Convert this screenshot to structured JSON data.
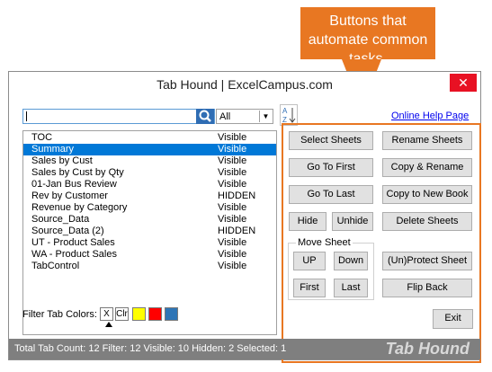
{
  "callout": {
    "text": "Buttons that automate common tasks."
  },
  "window": {
    "title": "Tab Hound | ExcelCampus.com",
    "close_glyph": "✕"
  },
  "toolbar": {
    "search_value": "",
    "filter_value": "All",
    "help_link": "Online Help Page"
  },
  "sheets": [
    {
      "name": "TOC",
      "visibility": "Visible"
    },
    {
      "name": "Summary",
      "visibility": "Visible"
    },
    {
      "name": "Sales by Cust",
      "visibility": "Visible"
    },
    {
      "name": "Sales by Cust by Qty",
      "visibility": "Visible"
    },
    {
      "name": "01-Jan Bus Review",
      "visibility": "Visible"
    },
    {
      "name": "Rev by Customer",
      "visibility": "HIDDEN"
    },
    {
      "name": "Revenue by Category",
      "visibility": "Visible"
    },
    {
      "name": "Source_Data",
      "visibility": "Visible"
    },
    {
      "name": "Source_Data (2)",
      "visibility": "HIDDEN"
    },
    {
      "name": "UT - Product Sales",
      "visibility": "Visible"
    },
    {
      "name": "WA - Product Sales",
      "visibility": "Visible"
    },
    {
      "name": "TabControl",
      "visibility": "Visible"
    }
  ],
  "buttons": {
    "select_sheets": "Select Sheets",
    "rename_sheets": "Rename Sheets",
    "go_to_first": "Go To First",
    "copy_rename": "Copy & Rename",
    "go_to_last": "Go To Last",
    "copy_to_new_book": "Copy to New Book",
    "hide": "Hide",
    "unhide": "Unhide",
    "delete_sheets": "Delete Sheets",
    "move_sheet_group": "Move Sheet",
    "up": "UP",
    "down": "Down",
    "first": "First",
    "last": "Last",
    "unprotect_sheet": "(Un)Protect Sheet",
    "flip_back": "Flip Back",
    "exit": "Exit"
  },
  "filter_colors": {
    "label": "Filter Tab Colors:",
    "clear_x": "X",
    "clear_text": "Clr",
    "swatches": [
      "#ffff00",
      "#ff0000",
      "#2e75b6"
    ]
  },
  "status": {
    "stats": "Total Tab Count: 12   Filter: 12   Visible: 10   Hidden: 2   Selected: 1",
    "brand": "Tab Hound"
  }
}
